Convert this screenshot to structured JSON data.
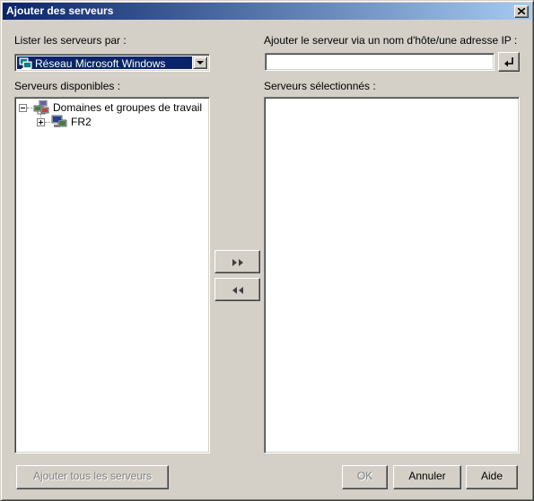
{
  "window": {
    "title": "Ajouter des serveurs",
    "close_icon": "close-icon"
  },
  "list_by": {
    "label": "Lister les serveurs par :",
    "selected": "Réseau Microsoft Windows",
    "icon": "network-icon"
  },
  "add_by_host": {
    "label": "Ajouter le serveur via un nom d'hôte/une adresse IP :",
    "value": "",
    "enter_icon": "enter-arrow-icon"
  },
  "available": {
    "label": "Serveurs disponibles :",
    "tree": [
      {
        "label": "Domaines et groupes de travail",
        "expanded": true,
        "icon": "workgroup-icon"
      },
      {
        "label": "FR2",
        "expanded": false,
        "icon": "computer-icon"
      }
    ]
  },
  "selected": {
    "label": "Serveurs sélectionnés :",
    "items": []
  },
  "transfer": {
    "add_icon": "double-right-arrow-icon",
    "remove_icon": "double-left-arrow-icon"
  },
  "footer": {
    "add_all_label": "Ajouter tous les serveurs",
    "ok_label": "OK",
    "cancel_label": "Annuler",
    "help_label": "Aide"
  },
  "colors": {
    "face": "#d4d0c8",
    "title_start": "#0a246a",
    "title_end": "#a6caf0",
    "selection": "#0a246a"
  }
}
